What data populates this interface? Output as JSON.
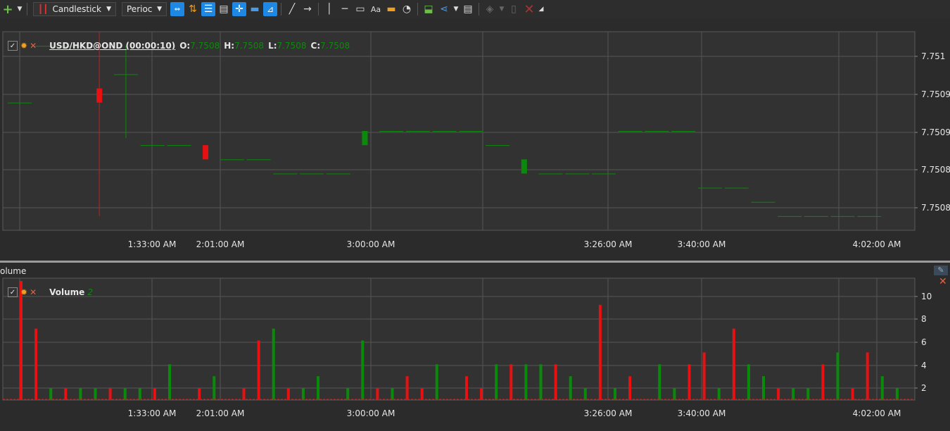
{
  "toolbar": {
    "chart_type": "Candlestick",
    "period": "Perioc",
    "icons": [
      "add-icon",
      "candlestick-icon",
      "line-style-icon",
      "sort-icon",
      "list-icon",
      "document-icon",
      "crosshair-icon",
      "comment-icon",
      "ruler-icon",
      "line-tool-icon",
      "arrow-tool-icon",
      "vertical-line-icon",
      "horizontal-line-icon",
      "rectangle-icon",
      "text-icon",
      "highlighter-icon",
      "gauge-icon",
      "export-icon",
      "share-icon",
      "notes-icon",
      "eraser-icon",
      "file-icon",
      "close-icon"
    ]
  },
  "price_pane": {
    "symbol": "USD/HKD@OND (00:00:10)",
    "o_label": "O:",
    "o_value": "7.7508",
    "h_label": "H:",
    "h_value": "7.7508",
    "l_label": "L:",
    "l_value": "7.7508",
    "c_label": "C:",
    "c_value": "7.7508"
  },
  "volume_pane": {
    "title": "olume",
    "indicator": "Volume",
    "indicator_value": "2"
  },
  "colors": {
    "up": "#0a8a0a",
    "down": "#e81010",
    "grid": "#555555",
    "background": "#2b2b2b"
  },
  "chart_data": [
    {
      "type": "candlestick",
      "x_tick_labels": [
        "1:33:00 AM",
        "2:01:00 AM",
        "3:00:00 AM",
        "3:26:00 AM",
        "3:40:00 AM",
        "4:02:00 AM"
      ],
      "y_tick_labels": [
        "7.751",
        "7.7509",
        "7.7509",
        "7.7508",
        "7.7508"
      ],
      "ylim": [
        7.75074,
        7.75102
      ],
      "candles": [
        {
          "o": 7.75092,
          "h": 7.75092,
          "l": 7.75092,
          "c": 7.75092
        },
        {
          "o": 7.751,
          "h": 7.751,
          "l": 7.751,
          "c": 7.751
        },
        {
          "o": 7.751,
          "h": 7.751,
          "l": 7.751,
          "c": 7.751
        },
        {
          "o": 7.75094,
          "h": 7.75102,
          "l": 7.75076,
          "c": 7.75092
        },
        {
          "o": 7.75096,
          "h": 7.751,
          "l": 7.75087,
          "c": 7.75096
        },
        {
          "o": 7.75086,
          "h": 7.75086,
          "l": 7.75086,
          "c": 7.75086
        },
        {
          "o": 7.75086,
          "h": 7.75086,
          "l": 7.75086,
          "c": 7.75086
        },
        {
          "o": 7.75086,
          "h": 7.75086,
          "l": 7.75086,
          "c": 7.75084
        },
        {
          "o": 7.75084,
          "h": 7.75084,
          "l": 7.75084,
          "c": 7.75084
        },
        {
          "o": 7.75084,
          "h": 7.75084,
          "l": 7.75084,
          "c": 7.75084
        },
        {
          "o": 7.75082,
          "h": 7.75082,
          "l": 7.75082,
          "c": 7.75082
        },
        {
          "o": 7.75082,
          "h": 7.75082,
          "l": 7.75082,
          "c": 7.75082
        },
        {
          "o": 7.75082,
          "h": 7.75082,
          "l": 7.75082,
          "c": 7.75082
        },
        {
          "o": 7.75086,
          "h": 7.75086,
          "l": 7.75086,
          "c": 7.75088
        },
        {
          "o": 7.75088,
          "h": 7.75088,
          "l": 7.75088,
          "c": 7.75088
        },
        {
          "o": 7.75088,
          "h": 7.75088,
          "l": 7.75088,
          "c": 7.75088
        },
        {
          "o": 7.75088,
          "h": 7.75088,
          "l": 7.75088,
          "c": 7.75088
        },
        {
          "o": 7.75088,
          "h": 7.75088,
          "l": 7.75088,
          "c": 7.75088
        },
        {
          "o": 7.75086,
          "h": 7.75086,
          "l": 7.75086,
          "c": 7.75086
        },
        {
          "o": 7.75082,
          "h": 7.75082,
          "l": 7.75082,
          "c": 7.75084
        },
        {
          "o": 7.75082,
          "h": 7.75082,
          "l": 7.75082,
          "c": 7.75082
        },
        {
          "o": 7.75082,
          "h": 7.75082,
          "l": 7.75082,
          "c": 7.75082
        },
        {
          "o": 7.75082,
          "h": 7.75082,
          "l": 7.75082,
          "c": 7.75082
        },
        {
          "o": 7.75088,
          "h": 7.75088,
          "l": 7.75088,
          "c": 7.75088
        },
        {
          "o": 7.75088,
          "h": 7.75088,
          "l": 7.75088,
          "c": 7.75088
        },
        {
          "o": 7.75088,
          "h": 7.75088,
          "l": 7.75088,
          "c": 7.75088
        },
        {
          "o": 7.7508,
          "h": 7.7508,
          "l": 7.7508,
          "c": 7.7508
        },
        {
          "o": 7.7508,
          "h": 7.7508,
          "l": 7.7508,
          "c": 7.7508
        },
        {
          "o": 7.75078,
          "h": 7.75078,
          "l": 7.75078,
          "c": 7.75078
        },
        {
          "o": 7.75076,
          "h": 7.75076,
          "l": 7.75076,
          "c": 7.75076
        },
        {
          "o": 7.75076,
          "h": 7.75076,
          "l": 7.75076,
          "c": 7.75076
        },
        {
          "o": 7.75076,
          "h": 7.75076,
          "l": 7.75076,
          "c": 7.75076
        },
        {
          "o": 7.75076,
          "h": 7.75076,
          "l": 7.75076,
          "c": 7.75076
        }
      ]
    },
    {
      "type": "bar",
      "series": [
        {
          "values": [
            11,
            7,
            2,
            2,
            2,
            2,
            2,
            2,
            2,
            2,
            4,
            1,
            2,
            3,
            1,
            2,
            6,
            7,
            2,
            2,
            3,
            1,
            2,
            6,
            2,
            2,
            3,
            2,
            4,
            1,
            3,
            2,
            4,
            4,
            4,
            4,
            4,
            3,
            2,
            9,
            2,
            3,
            1,
            4,
            2,
            4,
            5,
            2,
            7,
            4,
            3,
            2,
            2,
            2,
            4,
            5,
            2,
            5,
            3,
            2
          ]
        }
      ],
      "y_tick_labels": [
        "10",
        "8",
        "6",
        "4",
        "2"
      ],
      "ylim": [
        1,
        11
      ],
      "x_tick_labels": [
        "1:33:00 AM",
        "2:01:00 AM",
        "3:00:00 AM",
        "3:26:00 AM",
        "3:40:00 AM",
        "4:02:00 AM"
      ]
    }
  ]
}
